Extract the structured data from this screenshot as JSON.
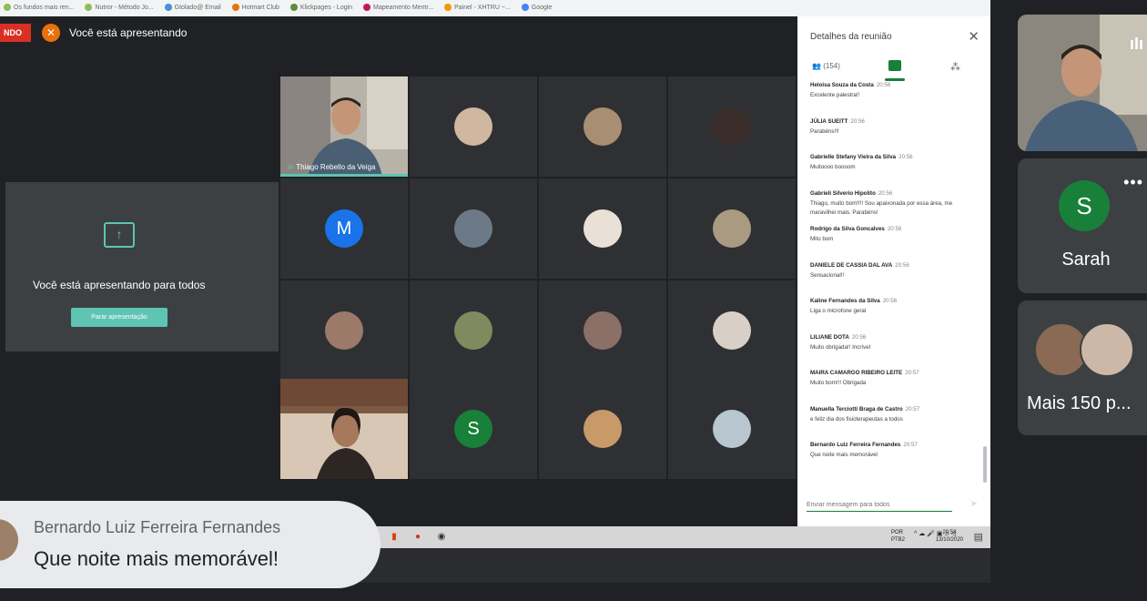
{
  "bookmarks": [
    "Os fundos mais ren...",
    "Nutror - Método Jo...",
    "Gtolado@ Email",
    "Hotmart Club",
    "Klickpages - Login",
    "Mapeamento Mentr...",
    "Painel - XHTRU ~...",
    "Google"
  ],
  "presenting": {
    "badge": "NDO",
    "bar_title": "Você está apresentando",
    "panel_text": "Você está apresentando para todos",
    "stop_button": "Parar apresentação"
  },
  "grid": {
    "featured_name": "Thiago Rebello da Veiga",
    "letter_avatars": [
      {
        "letter": "M",
        "color": "#1a73e8"
      },
      {
        "letter": "S",
        "color": "#188038"
      }
    ]
  },
  "chat": {
    "title": "Detalhes da reunião",
    "close_icon": "close-icon",
    "people_count": "(154)",
    "input_placeholder": "Enviar mensagem para todos",
    "messages": [
      {
        "sender": "Heloisa Souza da Costa",
        "time": "20:56",
        "text": "Excelente palestra!!"
      },
      {
        "sender": "JÚLIA SUEITT",
        "time": "20:56",
        "text": "Parabéns!!!"
      },
      {
        "sender": "Gabrielle Stefany Vieira da Silva",
        "time": "20:56",
        "text": "Muitoooo boooom"
      },
      {
        "sender": "Gabrieli Silverio Hipolito",
        "time": "20:56",
        "text": "Thiago, muito bom!!!! Sou apaixonada por essa área, me maravilhei mais. Parabéns!"
      },
      {
        "sender": "Rodrigo da Silva Goncalves",
        "time": "20:56",
        "text": "Mito bom"
      },
      {
        "sender": "DANIELE DE CASSIA DAL AVA",
        "time": "20:56",
        "text": "Sensacional!!"
      },
      {
        "sender": "Kaline Fernandes da Silva",
        "time": "20:56",
        "text": "Liga o microfone geral"
      },
      {
        "sender": "LILIANE DOTA",
        "time": "20:56",
        "text": "Muito obrigada!! Incrível"
      },
      {
        "sender": "MAIRA CAMARGO RIBEIRO LEITE",
        "time": "20:57",
        "text": "Muito bom!!! Obrigada"
      },
      {
        "sender": "Manuella Terciotti Braga de Castro",
        "time": "20:57",
        "text": "e feliz dia dos fisioterapeutas a todos"
      },
      {
        "sender": "Bernardo Luiz Ferreira Fernandes",
        "time": "20:57",
        "text": "Que noite mais memorável"
      }
    ]
  },
  "taskbar": {
    "lang": "POR",
    "layout": "PTB2",
    "time": "20:58",
    "date": "13/10/2020"
  },
  "caption": {
    "name": "Bernardo Luiz Ferreira Fernandes",
    "text": "Que noite mais memorável!"
  },
  "right_strip": {
    "sarah_initial": "S",
    "sarah_name": "Sarah",
    "more_label": "Mais 150 p..."
  }
}
